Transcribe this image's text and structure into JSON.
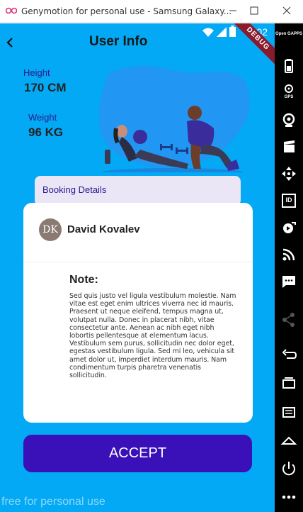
{
  "window": {
    "title": "Genymotion for personal use - Samsung Galaxy...",
    "watermark": "free for personal use"
  },
  "status_bar": {
    "time": "5:02",
    "debug_badge": "DEBUG"
  },
  "header": {
    "title": "User Info"
  },
  "stats": {
    "height_label": "Height",
    "height_value": "170 CM",
    "weight_label": "Weight",
    "weight_value": "96 KG"
  },
  "booking": {
    "tab_label": "Booking Details",
    "avatar_initials": "DK",
    "user_name": "David Kovalev",
    "note_title": "Note:",
    "note_text": "Sed quis justo vel ligula vestibulum molestie. Nam vitae est eget enim ultrices viverra nec id mauris. Praesent ut neque eleifend, tempus magna ut, volutpat nulla. Donec in placerat nibh, vitae consectetur ante. Aenean ac nibh eget nibh lobortis pellentesque at elementum lacus. Vestibulum sem purus, sollicitudin nec dolor eget, egestas vestibulum ligula. Sed mi leo, vehicula sit amet dolor ut, imperdiet interdum mauris. Nam condimentum turpis pharetra venenatis sollicitudin."
  },
  "actions": {
    "accept_label": "ACCEPT"
  },
  "toolbar": {
    "open_gapps_label": "Open GAPPS",
    "gps_label": "GPS",
    "id_label": "ID",
    "items": [
      "battery-icon",
      "gps-icon",
      "camera-icon",
      "video-icon",
      "move-icon",
      "identity-icon",
      "media-icon",
      "rss-icon",
      "sms-icon",
      "share-icon",
      "back-icon",
      "recent-apps-icon",
      "menu-icon",
      "home-icon",
      "power-icon",
      "more-icon"
    ]
  },
  "colors": {
    "screen_bg": "#03A9F4",
    "accent": "#3A10B8",
    "label": "#2A1A8C",
    "booking_tab_bg": "#EAE6F6"
  }
}
